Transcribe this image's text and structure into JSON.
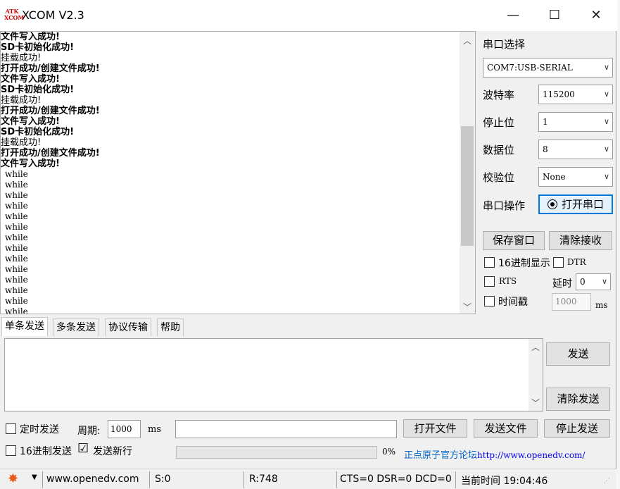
{
  "window": {
    "logo_top": "ATK",
    "logo_bottom": "XCOM",
    "title": "XCOM V2.3",
    "minimize": "—",
    "maximize": "☐",
    "close": "✕"
  },
  "receive": {
    "lines": [
      {
        "text": "文件写入成功!",
        "style": "bold"
      },
      {
        "text": "SD卡初始化成功!",
        "style": "bold"
      },
      {
        "text": "挂载成功!",
        "style": "normal"
      },
      {
        "text": "打开成功/创建文件成功!",
        "style": "bold"
      },
      {
        "text": "文件写入成功!",
        "style": "bold"
      },
      {
        "text": "SD卡初始化成功!",
        "style": "bold"
      },
      {
        "text": "挂载成功!",
        "style": "normal"
      },
      {
        "text": "打开成功/创建文件成功!",
        "style": "bold"
      },
      {
        "text": "文件写入成功!",
        "style": "bold"
      },
      {
        "text": "SD卡初始化成功!",
        "style": "bold"
      },
      {
        "text": "挂载成功!",
        "style": "normal"
      },
      {
        "text": "打开成功/创建文件成功!",
        "style": "bold"
      },
      {
        "text": "文件写入成功!",
        "style": "bold"
      },
      {
        "text": "while",
        "style": "mono"
      },
      {
        "text": "while",
        "style": "mono"
      },
      {
        "text": "while",
        "style": "mono"
      },
      {
        "text": "while",
        "style": "mono"
      },
      {
        "text": "while",
        "style": "mono"
      },
      {
        "text": "while",
        "style": "mono"
      },
      {
        "text": "while",
        "style": "mono"
      },
      {
        "text": "while",
        "style": "mono"
      },
      {
        "text": "while",
        "style": "mono"
      },
      {
        "text": "while",
        "style": "mono"
      },
      {
        "text": "while",
        "style": "mono"
      },
      {
        "text": "while",
        "style": "mono"
      },
      {
        "text": "while",
        "style": "mono"
      },
      {
        "text": "while",
        "style": "mono"
      }
    ]
  },
  "settings": {
    "port_select_label": "串口选择",
    "port_value": "COM7:USB-SERIAL",
    "baud_label": "波特率",
    "baud_value": "115200",
    "stopbits_label": "停止位",
    "stopbits_value": "1",
    "databits_label": "数据位",
    "databits_value": "8",
    "parity_label": "校验位",
    "parity_value": "None",
    "port_op_label": "串口操作",
    "open_port_button": "打开串口",
    "save_window_button": "保存窗口",
    "clear_receive_button": "清除接收",
    "hex_display_label": "16进制显示",
    "dtr_label": "DTR",
    "rts_label": "RTS",
    "delay_label": "延时",
    "delay_value": "0",
    "timestamp_label": "时间戳",
    "timestamp_value": "1000",
    "timestamp_unit": "ms"
  },
  "tabs": [
    "单条发送",
    "多条发送",
    "协议传输",
    "帮助"
  ],
  "send": {
    "send_button": "发送",
    "clear_send_button": "清除发送",
    "timed_send_label": "定时发送",
    "period_label": "周期:",
    "period_value": "1000",
    "period_unit": "ms",
    "open_file_button": "打开文件",
    "send_file_button": "发送文件",
    "stop_send_button": "停止发送",
    "hex_send_label": "16进制发送",
    "newline_label": "发送新行",
    "newline_checked": "☑",
    "progress_text": "0%",
    "forum_label": "正点原子官方论坛",
    "forum_url": "http://www.openedv.com/"
  },
  "statusbar": {
    "website": "www.openedv.com",
    "sent": "S:0",
    "received": "R:748",
    "lines_status": "CTS=0 DSR=0 DCD=0",
    "time_label": "当前时间 19:04:46"
  },
  "colors": {
    "accent_blue": "#0066cc",
    "link_blue": "#0000ee",
    "gear_orange": "#e85a1a"
  }
}
